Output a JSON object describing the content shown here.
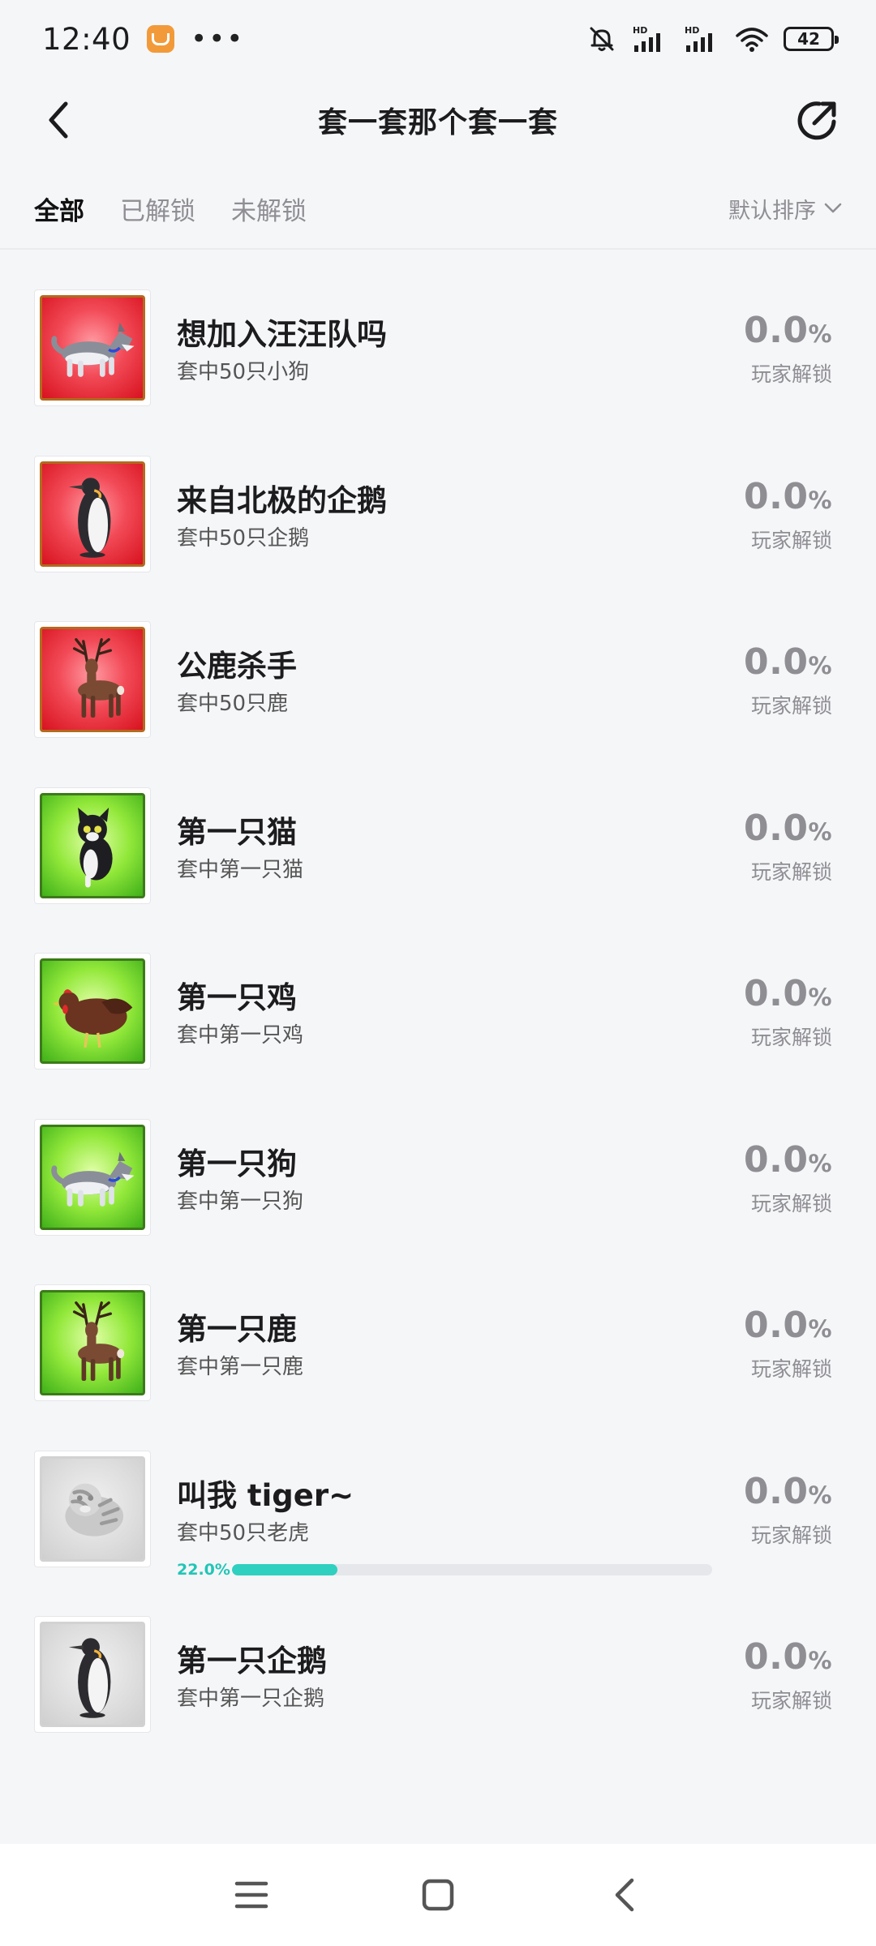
{
  "status_bar": {
    "time": "12:40",
    "app_icon": "shopping-bag-icon",
    "more": "•••",
    "battery": "42",
    "icons": [
      "muted-bell-icon",
      "signal-hd-icon",
      "signal-hd-icon",
      "wifi-icon"
    ]
  },
  "header": {
    "title": "套一套那个套一套",
    "back_icon": "chevron-left-icon",
    "share_icon": "share-arrow-icon"
  },
  "tabs": [
    {
      "label": "全部",
      "active": true
    },
    {
      "label": "已解锁",
      "active": false
    },
    {
      "label": "未解锁",
      "active": false
    }
  ],
  "sort": {
    "label": "默认排序",
    "icon": "chevron-down-icon"
  },
  "achievements": [
    {
      "title": "想加入汪汪队吗",
      "desc": "套中50只小狗",
      "percent": "0.0",
      "unit": "%",
      "label": "玩家解锁",
      "bg": "red",
      "animal": "husky",
      "progress": null
    },
    {
      "title": "来自北极的企鹅",
      "desc": "套中50只企鹅",
      "percent": "0.0",
      "unit": "%",
      "label": "玩家解锁",
      "bg": "red",
      "animal": "penguin",
      "progress": null
    },
    {
      "title": "公鹿杀手",
      "desc": "套中50只鹿",
      "percent": "0.0",
      "unit": "%",
      "label": "玩家解锁",
      "bg": "red",
      "animal": "deer",
      "progress": null
    },
    {
      "title": "第一只猫",
      "desc": "套中第一只猫",
      "percent": "0.0",
      "unit": "%",
      "label": "玩家解锁",
      "bg": "green",
      "animal": "cat",
      "progress": null
    },
    {
      "title": "第一只鸡",
      "desc": "套中第一只鸡",
      "percent": "0.0",
      "unit": "%",
      "label": "玩家解锁",
      "bg": "green",
      "animal": "chicken",
      "progress": null
    },
    {
      "title": "第一只狗",
      "desc": "套中第一只狗",
      "percent": "0.0",
      "unit": "%",
      "label": "玩家解锁",
      "bg": "green",
      "animal": "husky",
      "progress": null
    },
    {
      "title": "第一只鹿",
      "desc": "套中第一只鹿",
      "percent": "0.0",
      "unit": "%",
      "label": "玩家解锁",
      "bg": "green",
      "animal": "deer",
      "progress": null
    },
    {
      "title": "叫我 tiger~",
      "desc": "套中50只老虎",
      "percent": "0.0",
      "unit": "%",
      "label": "玩家解锁",
      "bg": "gray",
      "animal": "tiger",
      "progress": {
        "text": "22.0%",
        "value": 0.22
      }
    },
    {
      "title": "第一只企鹅",
      "desc": "套中第一只企鹅",
      "percent": "0.0",
      "unit": "%",
      "label": "玩家解锁",
      "bg": "gray",
      "animal": "penguin",
      "progress": null
    }
  ],
  "colors": {
    "accent": "#2fd0c0",
    "progress_text": "#21c6b6",
    "background": "#f5f6f8",
    "muted_text": "#8e8e93"
  },
  "nav": {
    "menu_icon": "menu-icon",
    "home_icon": "home-square-icon",
    "back_icon": "back-triangle-icon"
  }
}
